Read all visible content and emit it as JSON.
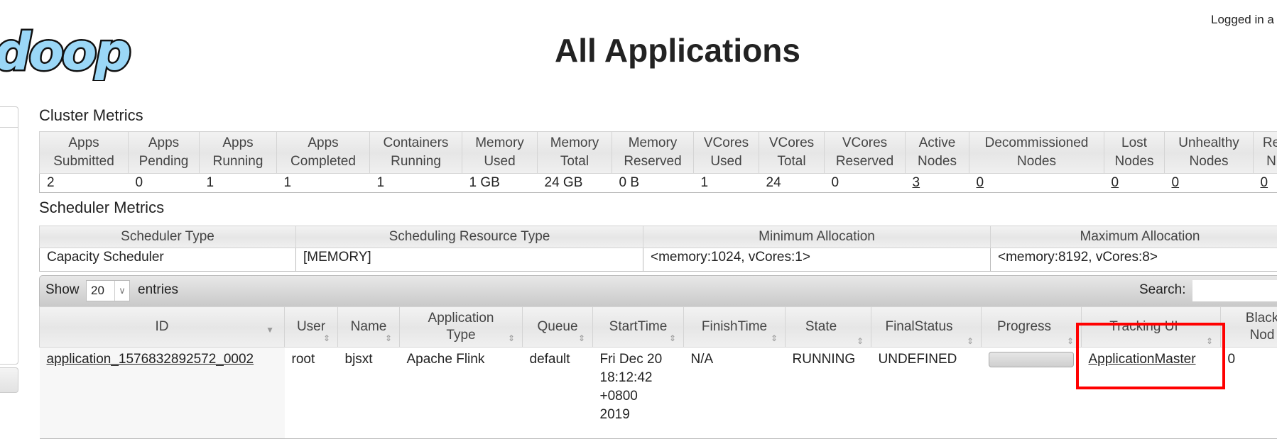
{
  "header": {
    "title": "All Applications",
    "login": "Logged in a",
    "logo_text": "doop"
  },
  "cluster": {
    "title": "Cluster Metrics",
    "headers": [
      [
        "Apps",
        "Submitted"
      ],
      [
        "Apps",
        "Pending"
      ],
      [
        "Apps",
        "Running"
      ],
      [
        "Apps",
        "Completed"
      ],
      [
        "Containers",
        "Running"
      ],
      [
        "Memory",
        "Used"
      ],
      [
        "Memory",
        "Total"
      ],
      [
        "Memory",
        "Reserved"
      ],
      [
        "VCores",
        "Used"
      ],
      [
        "VCores",
        "Total"
      ],
      [
        "VCores",
        "Reserved"
      ],
      [
        "Active",
        "Nodes"
      ],
      [
        "Decommissioned",
        "Nodes"
      ],
      [
        "Lost",
        "Nodes"
      ],
      [
        "Unhealthy",
        "Nodes"
      ],
      [
        "Re",
        "N"
      ]
    ],
    "values": [
      "2",
      "0",
      "1",
      "1",
      "1",
      "1 GB",
      "24 GB",
      "0 B",
      "1",
      "24",
      "0",
      "3",
      "0",
      "0",
      "0",
      "0"
    ]
  },
  "scheduler": {
    "title": "Scheduler Metrics",
    "headers": [
      "Scheduler Type",
      "Scheduling Resource Type",
      "Minimum Allocation",
      "Maximum Allocation"
    ],
    "values": [
      "Capacity Scheduler",
      "[MEMORY]",
      "<memory:1024, vCores:1>",
      "<memory:8192, vCores:8>"
    ]
  },
  "apps": {
    "show_label": "Show",
    "entries_value": "20",
    "entries_label": "entries",
    "search_label": "Search:",
    "search_value": "",
    "headers": [
      [
        "ID",
        ""
      ],
      [
        "User",
        ""
      ],
      [
        "Name",
        ""
      ],
      [
        "Application",
        "Type"
      ],
      [
        "Queue",
        ""
      ],
      [
        "StartTime",
        ""
      ],
      [
        "FinishTime",
        ""
      ],
      [
        "State",
        ""
      ],
      [
        "FinalStatus",
        ""
      ],
      [
        "Progress",
        ""
      ],
      [
        "Tracking UI",
        ""
      ],
      [
        "Black",
        "Nod"
      ]
    ],
    "rows": [
      {
        "id": "application_1576832892572_0002",
        "user": "root",
        "name": "bjsxt",
        "type": "Apache Flink",
        "queue": "default",
        "start": [
          "Fri Dec 20",
          "18:12:42",
          "+0800",
          "2019"
        ],
        "finish": "N/A",
        "state": "RUNNING",
        "final_status": "UNDEFINED",
        "progress_percent": 0,
        "tracking": "ApplicationMaster",
        "blacklisted": "0"
      }
    ]
  },
  "colors": {
    "highlight": "#ff0000",
    "logo": "#8fd3f5"
  }
}
